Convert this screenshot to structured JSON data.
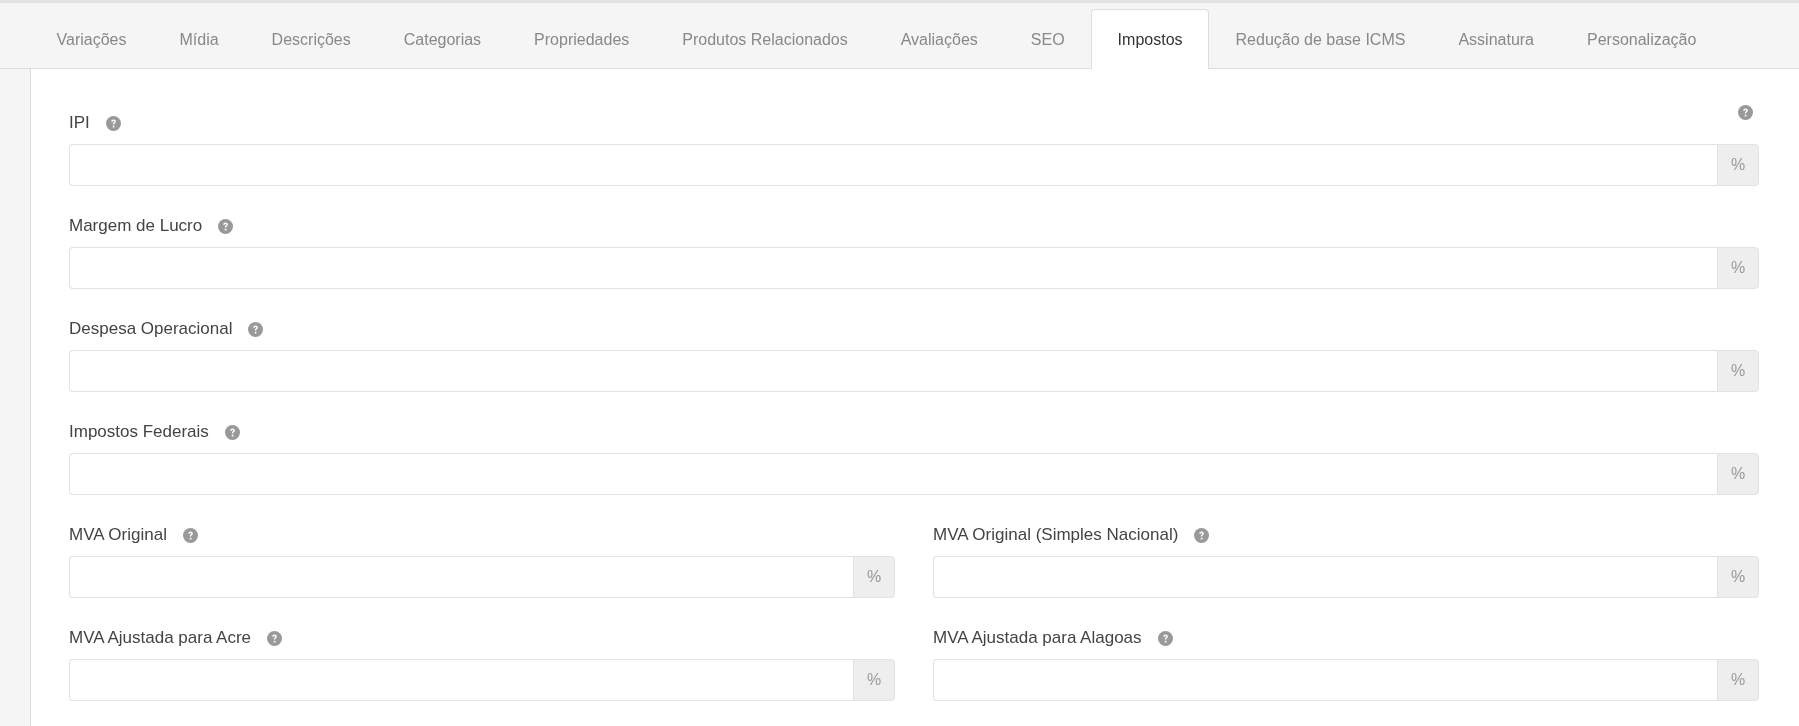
{
  "tabs": [
    {
      "label": "Variações",
      "selected": false
    },
    {
      "label": "Mídia",
      "selected": false
    },
    {
      "label": "Descrições",
      "selected": false
    },
    {
      "label": "Categorias",
      "selected": false
    },
    {
      "label": "Propriedades",
      "selected": false
    },
    {
      "label": "Produtos Relacionados",
      "selected": false
    },
    {
      "label": "Avaliações",
      "selected": false
    },
    {
      "label": "SEO",
      "selected": false
    },
    {
      "label": "Impostos",
      "selected": true
    },
    {
      "label": "Redução de base ICMS",
      "selected": false
    },
    {
      "label": "Assinatura",
      "selected": false
    },
    {
      "label": "Personalização",
      "selected": false
    }
  ],
  "rows": [
    {
      "fields": [
        {
          "label": "IPI",
          "unit": "%"
        }
      ]
    },
    {
      "fields": [
        {
          "label": "Margem de Lucro",
          "unit": "%"
        }
      ]
    },
    {
      "fields": [
        {
          "label": "Despesa Operacional",
          "unit": "%"
        }
      ]
    },
    {
      "fields": [
        {
          "label": "Impostos Federais",
          "unit": "%"
        }
      ]
    },
    {
      "fields": [
        {
          "label": "MVA Original",
          "unit": "%"
        },
        {
          "label": "MVA Original (Simples Nacional)",
          "unit": "%"
        }
      ]
    },
    {
      "fields": [
        {
          "label": "MVA Ajustada para Acre",
          "unit": "%"
        },
        {
          "label": "MVA Ajustada para Alagoas",
          "unit": "%"
        }
      ]
    }
  ]
}
